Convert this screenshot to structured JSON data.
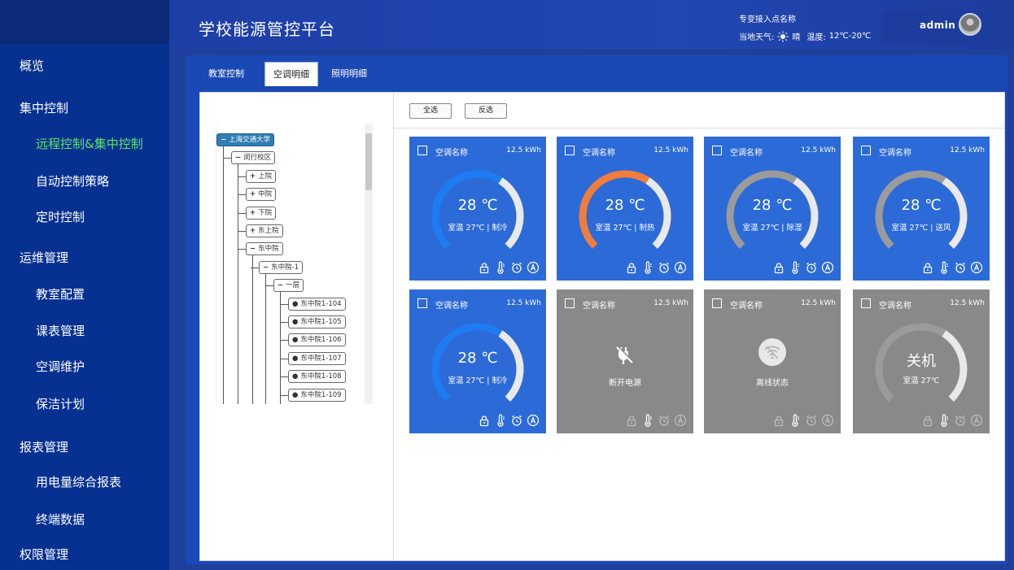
{
  "sidebar": {
    "groups": [
      "概览",
      "集中控制",
      "运维管理",
      "报表管理",
      "权限管理"
    ],
    "items": [
      "远程控制&集中控制",
      "自动控制策略",
      "定时控制",
      "教室配置",
      "课表管理",
      "空调维护",
      "保洁计划",
      "用电量综合报表",
      "终端数据"
    ]
  },
  "header": {
    "title": "学校能源管控平台",
    "access_point": "专变接入点名称",
    "weather_label": "当地天气:",
    "weather_icon": "sun-icon",
    "weather_condition": "晴",
    "temperature_label": "温度:",
    "temperature_range": "12℃-20℃",
    "user": "admin"
  },
  "tabs": [
    "教室控制",
    "空调明细",
    "照明明细"
  ],
  "active_tab": 1,
  "toolbar": {
    "select_all": "全选",
    "invert_select": "反选"
  },
  "tree": {
    "root": "上海交通大学",
    "campus": "闵行校区",
    "courts": [
      "上院",
      "中院",
      "下院",
      "东上院",
      "东中院"
    ],
    "building": "东中院-1",
    "floor": "一层",
    "rooms": [
      "东中院1-104",
      "东中院1-105",
      "东中院1-106",
      "东中院1-107",
      "东中院1-108",
      "东中院1-109"
    ]
  },
  "colors": {
    "card_on": "#2c6ad8",
    "card_off": "#898989",
    "arc_blue": "#1e7cf2",
    "arc_orange": "#f07d3c",
    "arc_gray": "#9b9b9b",
    "active_nav": "#5fe36d"
  },
  "cards": [
    {
      "name": "空调名称",
      "energy": "12.5 kWh",
      "state": "on",
      "temp": "28 ℃",
      "status": "室温 27℃ | 制冷",
      "arc": "blue",
      "level": 0.62
    },
    {
      "name": "空调名称",
      "energy": "12.5 kWh",
      "state": "on",
      "temp": "28 ℃",
      "status": "室温 27℃ | 制热",
      "arc": "orange",
      "level": 0.62
    },
    {
      "name": "空调名称",
      "energy": "12.5 kWh",
      "state": "on",
      "temp": "28 ℃",
      "status": "室温 27℃ | 除湿",
      "arc": "gray",
      "level": 0.62
    },
    {
      "name": "空调名称",
      "energy": "12.5 kWh",
      "state": "on",
      "temp": "28 ℃",
      "status": "室温 27℃ | 送风",
      "arc": "gray",
      "level": 0.62
    },
    {
      "name": "空调名称",
      "energy": "12.5 kWh",
      "state": "on",
      "temp": "28 ℃",
      "status": "室温 27℃ | 制冷",
      "arc": "blue",
      "level": 0.62
    },
    {
      "name": "空调名称",
      "energy": "12.5 kWh",
      "state": "unplugged",
      "status": "断开电源",
      "icon": "unplugged-icon"
    },
    {
      "name": "空调名称",
      "energy": "12.5 kWh",
      "state": "offline",
      "status": "离线状态",
      "icon": "wifi-off-icon"
    },
    {
      "name": "空调名称",
      "energy": "12.5 kWh",
      "state": "off",
      "temp": "关机",
      "status": "室温 27℃",
      "arc": "gray",
      "level": 0.62
    }
  ],
  "card_icons": [
    "lock-icon",
    "thermometer-icon",
    "alarm-clock-icon",
    "auto-mode-icon"
  ]
}
